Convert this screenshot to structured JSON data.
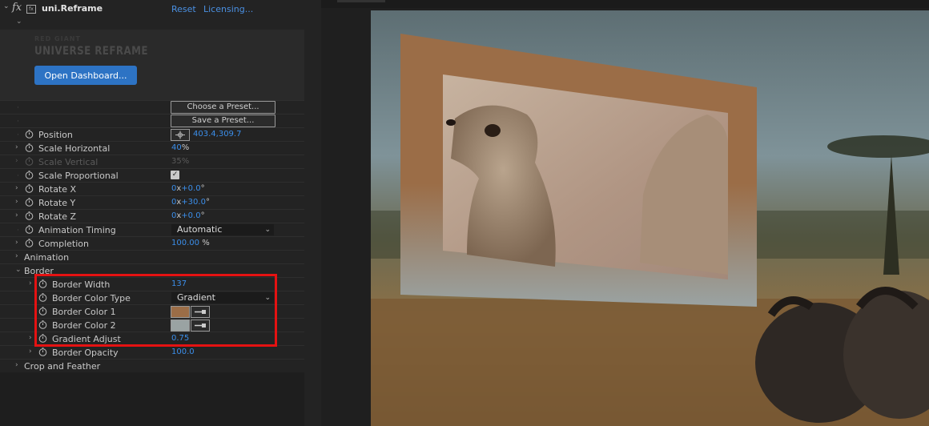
{
  "effect": {
    "name": "uni.Reframe",
    "reset_label": "Reset",
    "licensing_label": "Licensing...",
    "logo_small": "RED GIANT",
    "logo_big": "UNIVERSE REFRAME",
    "open_dashboard_label": "Open Dashboard..."
  },
  "presets": {
    "choose_label": "Choose a Preset...",
    "save_label": "Save a Preset..."
  },
  "params": {
    "position": {
      "label": "Position",
      "x": "403.4",
      "y": "309.7"
    },
    "scale_horizontal": {
      "label": "Scale Horizontal",
      "value": "40",
      "unit": "%"
    },
    "scale_vertical": {
      "label": "Scale Vertical",
      "value": "35",
      "unit": "%"
    },
    "scale_proportional": {
      "label": "Scale Proportional",
      "checked": true
    },
    "rotate_x": {
      "label": "Rotate X",
      "rev": "0",
      "deg": "+0.0"
    },
    "rotate_y": {
      "label": "Rotate Y",
      "rev": "0",
      "deg": "+30.0"
    },
    "rotate_z": {
      "label": "Rotate Z",
      "rev": "0",
      "deg": "+0.0"
    },
    "animation_timing": {
      "label": "Animation Timing",
      "value": "Automatic"
    },
    "completion": {
      "label": "Completion",
      "value": "100.00",
      "unit": "%"
    },
    "animation_group": {
      "label": "Animation"
    },
    "border_group": {
      "label": "Border"
    },
    "border_width": {
      "label": "Border Width",
      "value": "137"
    },
    "border_color_type": {
      "label": "Border Color Type",
      "value": "Gradient"
    },
    "border_color_1": {
      "label": "Border Color 1",
      "color": "#9b6d47"
    },
    "border_color_2": {
      "label": "Border Color 2",
      "color": "#9aa3a3"
    },
    "gradient_adjust": {
      "label": "Gradient Adjust",
      "value": "0.75"
    },
    "border_opacity": {
      "label": "Border Opacity",
      "value": "100.0"
    },
    "crop_group": {
      "label": "Crop and Feather"
    }
  },
  "symbols": {
    "x": "x",
    "degree": "°",
    "check": "✓",
    "twirl_closed": "›",
    "twirl_open": "⌄",
    "dropdown_arrow": "⌄"
  },
  "colors": {
    "accent_blue": "#3b8eea",
    "button_blue": "#2d73c4",
    "highlight_red": "#e51212"
  },
  "composition": {
    "border_gradient": [
      "#9b6d47",
      "#9aa3a3"
    ]
  }
}
